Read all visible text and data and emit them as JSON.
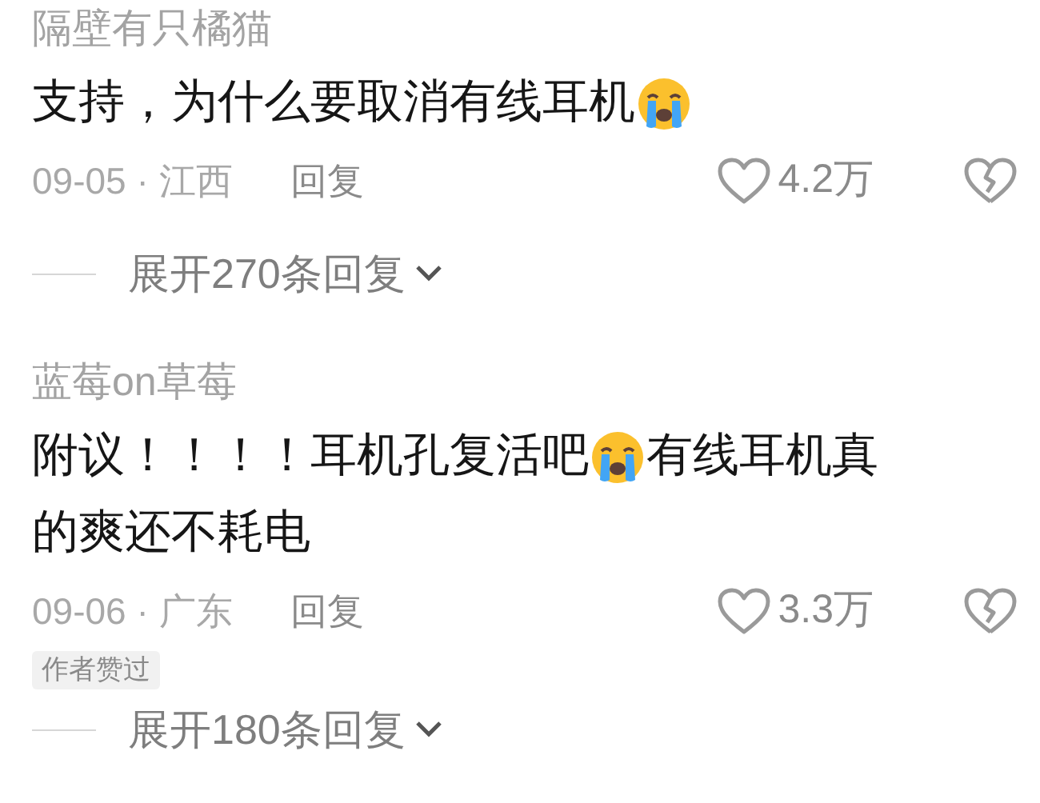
{
  "comments": [
    {
      "username": "隔壁有只橘猫",
      "lines": [
        [
          {
            "kind": "text",
            "text": "支持，为什么要取消有线耳机"
          },
          {
            "kind": "emoji"
          }
        ]
      ],
      "meta": "09-05 · 江西",
      "reply": "回复",
      "likes": "4.2万",
      "liked": false,
      "expand": "展开270条回复"
    },
    {
      "username": "蓝莓on草莓",
      "lines": [
        [
          {
            "kind": "text",
            "text": "附议！！！！耳机孔复活吧"
          },
          {
            "kind": "emoji"
          },
          {
            "kind": "text",
            "text": "有线耳机真"
          }
        ],
        [
          {
            "kind": "text",
            "text": "的爽还不耗电"
          }
        ]
      ],
      "meta": "09-06 · 广东",
      "reply": "回复",
      "likes": "3.3万",
      "liked": false,
      "author_liked": "作者赞过",
      "expand": "展开180条回复"
    }
  ]
}
